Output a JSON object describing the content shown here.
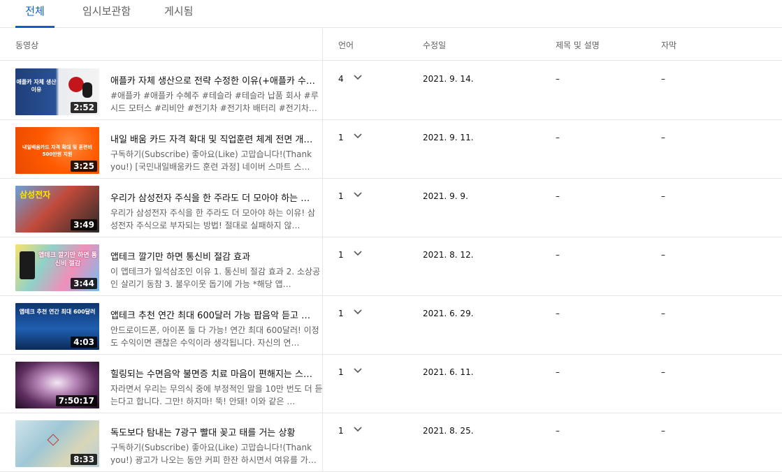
{
  "tabs": [
    {
      "label": "전체",
      "active": true
    },
    {
      "label": "임시보관함",
      "active": false
    },
    {
      "label": "게시됨",
      "active": false
    }
  ],
  "columns": {
    "video": "동영상",
    "language": "언어",
    "modified": "수정일",
    "title_desc": "제목 및 설명",
    "subtitles": "자막"
  },
  "colors": {
    "accent": "#065fd4",
    "divider": "#e6e6e6",
    "secondary_text": "#606060"
  },
  "rows": [
    {
      "title": "애플카 자체 생산으로 전략 수정한 이유(+애플카 수…",
      "desc": "#애플카 #애플카 수혜주 #테슬라 #테슬라 납품 회사 #루시드 모터스 #리비안 #전기차 #전기차 배터리 #전기차…",
      "duration": "2:52",
      "thumb_text": "애플카 자체 생산 이유",
      "language": "4",
      "date": "2021. 9. 14.",
      "title_desc": "–",
      "subtitles": "–"
    },
    {
      "title": "내일 배움 카드 자격 확대 및 직업훈련 체계 전면 개…",
      "desc": "구독하기(Subscribe) 좋아요(Like) 고맙습니다!(Thank you!) [국민내일배움카드 훈련 과정] 네이버 스마트 스…",
      "duration": "3:25",
      "thumb_text": "내일배움카드 자격 확대 및 훈련비 500만원 지원",
      "language": "1",
      "date": "2021. 9. 11.",
      "title_desc": "–",
      "subtitles": "–"
    },
    {
      "title": "우리가 삼성전자 주식을 한 주라도 더 모아야 하는 …",
      "desc": "우리가 삼성전자 주식을 한 주라도 더 모아야 하는 이유! 삼성전자 주식으로 부자되는 방법! 절대로 실패하지 않…",
      "duration": "3:49",
      "thumb_text": "삼성전자",
      "language": "1",
      "date": "2021. 9. 9.",
      "title_desc": "–",
      "subtitles": "–"
    },
    {
      "title": "앱테크 깔기만 하면 통신비 절감 효과",
      "desc": "이 앱테크가 일석삼조인 이유 1. 통신비 절감 효과 2. 소상공인 살리기 동참 3. 불우이웃 돕기에 가능 *해당 앱…",
      "duration": "3:44",
      "thumb_text": "앱테크 깔기만 하면 통신비 절감",
      "language": "1",
      "date": "2021. 8. 12.",
      "title_desc": "–",
      "subtitles": "–"
    },
    {
      "title": "앱테크 추천 연간 최대 600달러 가능 팝음악 듣고 …",
      "desc": "안드로이드폰, 아이폰 둘 다 가능! 연간 최대 600달러! 이정도 수익이면 괜찮은 수익이라 생각됩니다. 자신의 연…",
      "duration": "4:03",
      "thumb_text": "앱테크 추천 연간 최대 600달러",
      "language": "1",
      "date": "2021. 6. 29.",
      "title_desc": "–",
      "subtitles": "–"
    },
    {
      "title": "힐링되는 수면음악 불면증 치료 마음이 편해지는 스…",
      "desc": "자라면서 우리는 무의식 중에 부정적인 말을 10만 번도 더 듣는다고 합니다. 그만! 하지마! 뚝! 안돼! 이와 같은 …",
      "duration": "7:50:17",
      "thumb_text": "",
      "language": "1",
      "date": "2021. 6. 11.",
      "title_desc": "–",
      "subtitles": "–"
    },
    {
      "title": "독도보다 탐내는 7광구 빨대 꽂고 태를 거는 상황",
      "desc": "구독하기(Subscribe) 좋아요(Like) 고맙습니다!(Thank you!) 광고가 나오는 동안 커피 한잔 하시면서 여유를 가…",
      "duration": "8:33",
      "thumb_text": "",
      "language": "1",
      "date": "2021. 8. 25.",
      "title_desc": "–",
      "subtitles": "–"
    }
  ]
}
